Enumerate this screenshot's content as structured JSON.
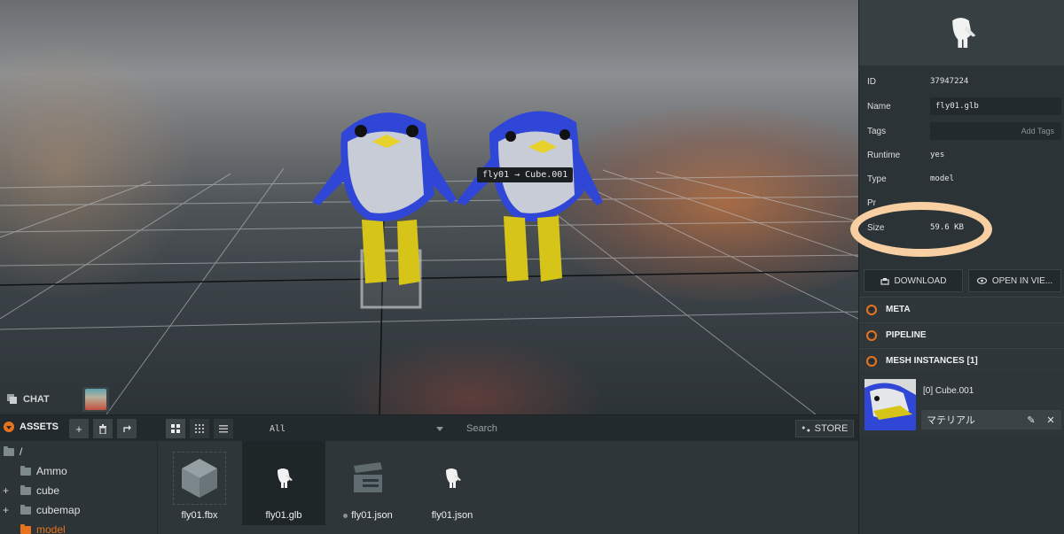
{
  "viewport": {
    "tooltip": "fly01 → Cube.001"
  },
  "chat": {
    "label": "CHAT"
  },
  "assets": {
    "title": "ASSETS",
    "filter_value": "All",
    "search_placeholder": "Search",
    "store_label": "STORE",
    "tree": [
      {
        "label": "/",
        "expandable": false,
        "active": false
      },
      {
        "label": "Ammo",
        "expandable": false,
        "active": false
      },
      {
        "label": "cube",
        "expandable": true,
        "active": false
      },
      {
        "label": "cubemap",
        "expandable": true,
        "active": false
      },
      {
        "label": "model",
        "expandable": false,
        "active": true
      }
    ],
    "files": [
      {
        "name": "fly01.fbx",
        "kind": "model-source",
        "selected": false
      },
      {
        "name": "fly01.glb",
        "kind": "model",
        "selected": true
      },
      {
        "name": "fly01.json",
        "kind": "json",
        "selected": false
      },
      {
        "name": "fly01.json",
        "kind": "model",
        "selected": false
      }
    ]
  },
  "inspector": {
    "fields": {
      "id_label": "ID",
      "id_value": "37947224",
      "name_label": "Name",
      "name_value": "fly01.glb",
      "tags_label": "Tags",
      "tags_placeholder": "Add Tags",
      "runtime_label": "Runtime",
      "runtime_value": "yes",
      "type_label": "Type",
      "type_value": "model",
      "preload_label": "Pr",
      "size_label": "Size",
      "size_value": "59.6 KB"
    },
    "download_label": "DOWNLOAD",
    "open_label": "OPEN IN VIE...",
    "sections": [
      "META",
      "PIPELINE",
      "MESH INSTANCES [1]"
    ],
    "mesh_instance_label": "[0] Cube.001",
    "material_label": "マテリアル"
  },
  "colors": {
    "accent": "#e8731d",
    "highlight": "#f7cfa2",
    "panel": "#2b3336",
    "penguin_blue": "#2f46d6",
    "penguin_yellow": "#d6c419"
  }
}
